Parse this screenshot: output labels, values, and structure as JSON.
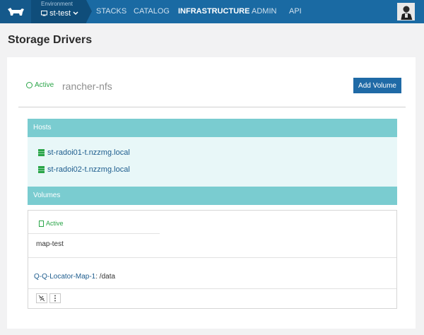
{
  "header": {
    "environment_label": "Environment",
    "environment_name": "st-test",
    "nav": [
      {
        "label": "STACKS",
        "active": false
      },
      {
        "label": "CATALOG",
        "active": false
      },
      {
        "label": "INFRASTRUCTURE",
        "active": true
      },
      {
        "label": "ADMIN",
        "active": false
      },
      {
        "label": "API",
        "active": false
      }
    ]
  },
  "page": {
    "title": "Storage Drivers"
  },
  "driver": {
    "status": "Active",
    "name": "rancher-nfs",
    "add_button": "Add Volume"
  },
  "hosts": {
    "header": "Hosts",
    "items": [
      "st-radoi01-t.nzzmg.local",
      "st-radoi02-t.nzzmg.local"
    ]
  },
  "volumes": {
    "header": "Volumes",
    "items": [
      {
        "status": "Active",
        "name": "map-test",
        "mount_container": "Q-Q-Locator-Map-1",
        "mount_path": ": /data"
      }
    ]
  },
  "colors": {
    "topbar": "#1a6aa3",
    "accent_teal": "#7accd0",
    "active_green": "#2aa548",
    "button_blue": "#1f6aa6"
  }
}
